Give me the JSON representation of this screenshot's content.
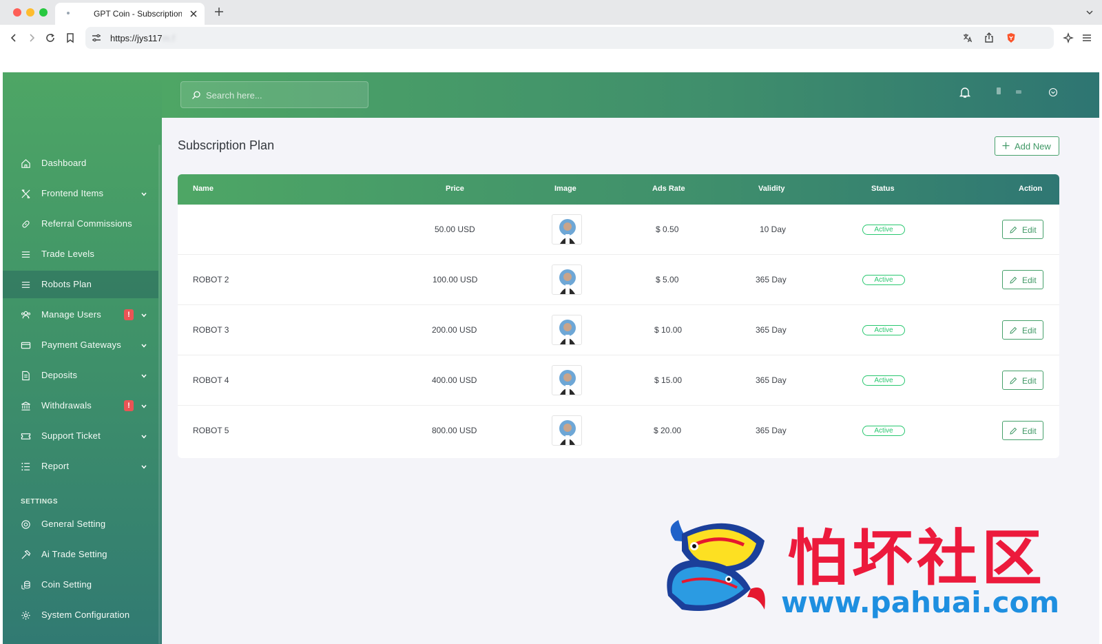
{
  "browser": {
    "tab_title": "GPT Coin - Subscription",
    "url_visible": "https://jys117",
    "url_obscured": "m.f"
  },
  "header": {
    "search_placeholder": "Search here..."
  },
  "sidebar": {
    "items": [
      {
        "label": "Dashboard",
        "icon": "home-icon",
        "has_chevron": false
      },
      {
        "label": "Frontend Items",
        "icon": "tools-icon",
        "has_chevron": true
      },
      {
        "label": "Referral Commissions",
        "icon": "link-icon",
        "has_chevron": false
      },
      {
        "label": "Trade Levels",
        "icon": "list-icon",
        "has_chevron": false
      },
      {
        "label": "Robots Plan",
        "icon": "list-icon",
        "has_chevron": false,
        "active": true
      },
      {
        "label": "Manage Users",
        "icon": "users-icon",
        "has_chevron": true,
        "badge": "!"
      },
      {
        "label": "Payment Gateways",
        "icon": "credit-card-icon",
        "has_chevron": true
      },
      {
        "label": "Deposits",
        "icon": "deposit-icon",
        "has_chevron": true
      },
      {
        "label": "Withdrawals",
        "icon": "bank-icon",
        "has_chevron": true,
        "badge": "!"
      },
      {
        "label": "Support Ticket",
        "icon": "ticket-icon",
        "has_chevron": true
      },
      {
        "label": "Report",
        "icon": "report-list-icon",
        "has_chevron": true
      }
    ],
    "settings_heading": "SETTINGS",
    "settings_items": [
      {
        "label": "General Setting",
        "icon": "lifebuoy-icon"
      },
      {
        "label": "Ai Trade Setting",
        "icon": "hammer-icon"
      },
      {
        "label": "Coin Setting",
        "icon": "coins-icon"
      },
      {
        "label": "System Configuration",
        "icon": "gear-icon"
      }
    ]
  },
  "main": {
    "title": "Subscription Plan",
    "add_button": "Add New",
    "columns": [
      "Name",
      "Price",
      "Image",
      "Ads Rate",
      "Validity",
      "Status",
      "Action"
    ],
    "rows": [
      {
        "name": "",
        "price": "50.00 USD",
        "ads_rate": "$ 0.50",
        "validity": "10 Day",
        "status": "Active",
        "action": "Edit"
      },
      {
        "name": "ROBOT 2",
        "price": "100.00 USD",
        "ads_rate": "$ 5.00",
        "validity": "365 Day",
        "status": "Active",
        "action": "Edit"
      },
      {
        "name": "ROBOT 3",
        "price": "200.00 USD",
        "ads_rate": "$ 10.00",
        "validity": "365 Day",
        "status": "Active",
        "action": "Edit"
      },
      {
        "name": "ROBOT 4",
        "price": "400.00 USD",
        "ads_rate": "$ 15.00",
        "validity": "365 Day",
        "status": "Active",
        "action": "Edit"
      },
      {
        "name": "ROBOT 5",
        "price": "800.00 USD",
        "ads_rate": "$ 20.00",
        "validity": "365 Day",
        "status": "Active",
        "action": "Edit"
      }
    ]
  },
  "watermark": {
    "title": "怕坏社区",
    "url": "www.pahuai.com"
  },
  "colors": {
    "brand_green": "#4ea665",
    "brand_teal": "#2e7572",
    "status_green": "#28c76f",
    "badge_red": "#ea5455"
  }
}
